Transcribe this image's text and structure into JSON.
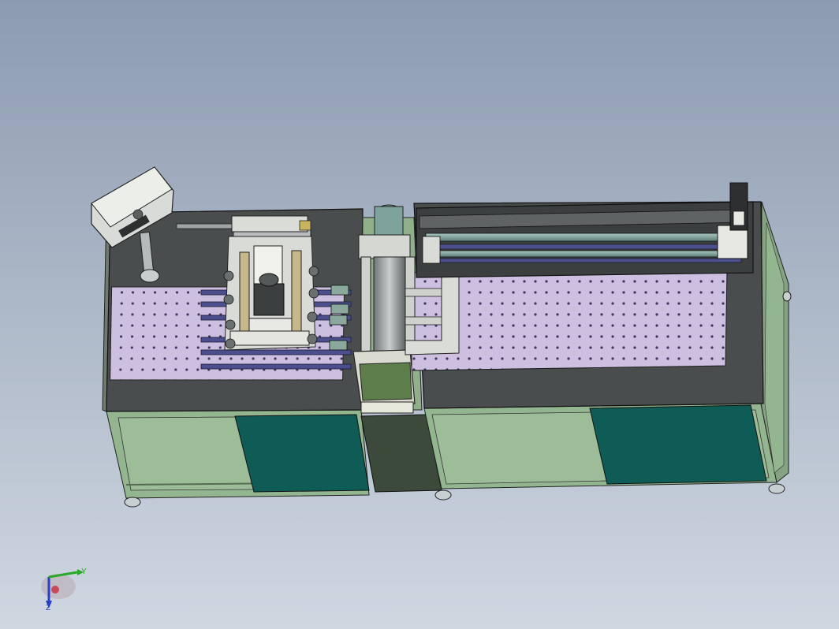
{
  "scene": {
    "kind": "3d-cad-viewport",
    "background_top": "#8d9bb0",
    "background_bottom": "#cfd7e1",
    "frame_color": "#8fb08a",
    "panel_color": "#0f5c56",
    "tabletop_color": "#4a4d4e",
    "fixture_plate_color": "#c9b8d8",
    "rail_color": "#4b4f8e"
  },
  "triad": {
    "y_label": "Y",
    "z_label": "Z",
    "y_color": "#2aa82a",
    "z_color": "#2a3fc8"
  }
}
